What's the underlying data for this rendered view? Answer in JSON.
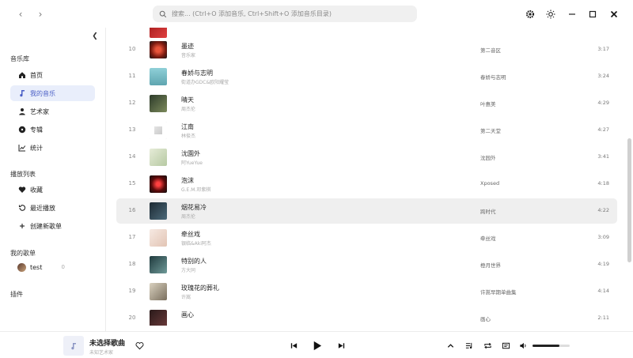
{
  "search": {
    "placeholder": "搜索... (Ctrl+O 添加音乐, Ctrl+Shift+O 添加音乐目录)"
  },
  "sidebar": {
    "library_title": "音乐库",
    "library_items": [
      {
        "label": "首页",
        "icon": "home-icon"
      },
      {
        "label": "我的音乐",
        "icon": "music-note-icon"
      },
      {
        "label": "艺术家",
        "icon": "person-icon"
      },
      {
        "label": "专辑",
        "icon": "disc-icon"
      },
      {
        "label": "统计",
        "icon": "chart-icon"
      }
    ],
    "playlists_title": "播放列表",
    "playlist_items": [
      {
        "label": "收藏",
        "icon": "heart-icon"
      },
      {
        "label": "最近播放",
        "icon": "history-icon"
      },
      {
        "label": "创建新歌单",
        "icon": "plus-icon"
      }
    ],
    "my_playlists_title": "我的歌单",
    "my_playlists": [
      {
        "label": "test",
        "count": "0"
      }
    ],
    "plugins_title": "插件"
  },
  "songs": [
    {
      "index": "10",
      "title": "墨迹",
      "artist": "音乐家",
      "album": "第二音区",
      "duration": "3:17"
    },
    {
      "index": "11",
      "title": "春娇与志明",
      "artist": "街道办GDC&欧阳耀莹",
      "album": "春娇与志明",
      "duration": "3:24"
    },
    {
      "index": "12",
      "title": "晴天",
      "artist": "周杰伦",
      "album": "叶惠美",
      "duration": "4:29"
    },
    {
      "index": "13",
      "title": "江南",
      "artist": "林俊杰",
      "album": "第二天堂",
      "duration": "4:27"
    },
    {
      "index": "14",
      "title": "沈園外",
      "artist": "阿YueYue",
      "album": "沈园外",
      "duration": "3:41"
    },
    {
      "index": "15",
      "title": "泡沫",
      "artist": "G.E.M.邓紫棋",
      "album": "Xposed",
      "duration": "4:18"
    },
    {
      "index": "16",
      "title": "烟花易冷",
      "artist": "周杰伦",
      "album": "跨时代",
      "duration": "4:22"
    },
    {
      "index": "17",
      "title": "牵丝戏",
      "artist": "银临&Aki阿杰",
      "album": "牵丝戏",
      "duration": "3:09"
    },
    {
      "index": "18",
      "title": "特别的人",
      "artist": "方大同",
      "album": "橙月世界",
      "duration": "4:19"
    },
    {
      "index": "19",
      "title": "玫瑰花的葬礼",
      "artist": "许嵩",
      "album": "许嵩早期单曲集",
      "duration": "4:14"
    },
    {
      "index": "20",
      "title": "画心",
      "artist": "",
      "album": "画心",
      "duration": "2:11"
    }
  ],
  "player": {
    "title": "未选择歌曲",
    "artist": "未知艺术家",
    "volume": 0.72
  }
}
